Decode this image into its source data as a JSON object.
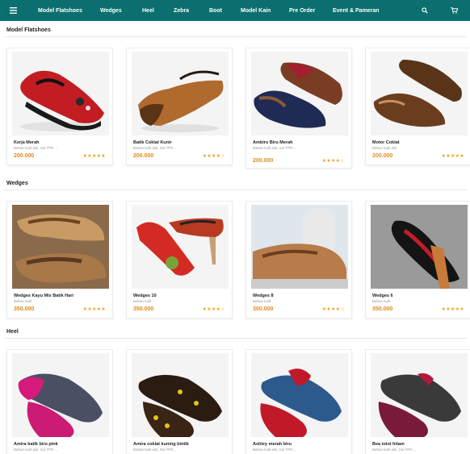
{
  "nav": {
    "links": [
      "Model Flatshoes",
      "Wedges",
      "Heel",
      "Zebra",
      "Boot",
      "Model Kain",
      "Pre Order",
      "Event & Pameran"
    ]
  },
  "sections": [
    {
      "title": "Model Flatshoes",
      "products": [
        {
          "name": "Kerja Merah",
          "desc": "Bahan kulit asli, Sol TPR ...",
          "price": "200.000",
          "rating": 5
        },
        {
          "name": "Batik Coklat Kunir",
          "desc": "Bahan kulit asli, Sol TPR ...",
          "price": "200.000",
          "rating": 4.5
        },
        {
          "name": "Ambiru Biru Merah",
          "desc": "Bahan kulit asli, Sol TPR ...",
          "price": "200.000",
          "rating": 4.5
        },
        {
          "name": "Motor Coklat",
          "desc": "Bahan kulit asli",
          "price": "200.000",
          "rating": 5
        }
      ]
    },
    {
      "title": "Wedges",
      "products": [
        {
          "name": "Wedges Kayu Mix Batik Hari",
          "desc": "Bahan kulit",
          "price": "350.000",
          "rating": 5
        },
        {
          "name": "Wedges 10",
          "desc": "Bahan kulit",
          "price": "350.000",
          "rating": 4.5
        },
        {
          "name": "Wedges 8",
          "desc": "Bahan kulit",
          "price": "300.000",
          "rating": 4.5
        },
        {
          "name": "Wedges 6",
          "desc": "Bahan kulit",
          "price": "350.000",
          "rating": 5
        }
      ]
    },
    {
      "title": "Heel",
      "products": [
        {
          "name": "Amira batik biru pink",
          "desc": "Bahan kulit asli, Sol TPR ...",
          "price": "",
          "rating": 0
        },
        {
          "name": "Amira coklat kuning bintik",
          "desc": "Bahan kulit asli, Sol TPR ...",
          "price": "",
          "rating": 0
        },
        {
          "name": "Ashley merah biru",
          "desc": "Bahan kulit asli, Sol TPR ...",
          "price": "",
          "rating": 0
        },
        {
          "name": "Bea totol hitam",
          "desc": "Bahan kulit asli, Sol TPR ...",
          "price": "",
          "rating": 0
        }
      ]
    }
  ],
  "colors": {
    "navbar": "#0b6f6f",
    "price": "#e08c1a",
    "stars": "#f0a020"
  }
}
